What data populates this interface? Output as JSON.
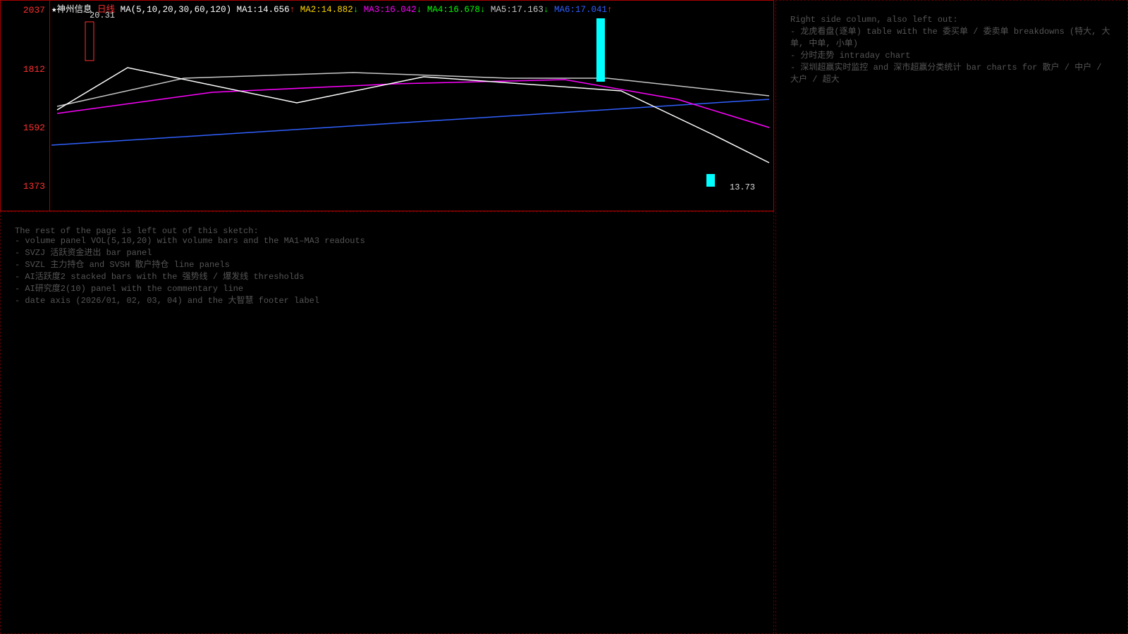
{
  "main": {
    "title": "★神州信息",
    "period": "日线",
    "ticks": [
      "2037",
      "1812",
      "1592",
      "1373"
    ],
    "ma_label": "MA(5,10,20,30,60,120)",
    "ma": [
      {
        "name": "MA1:",
        "value": "14.656",
        "arrow": "↑",
        "color": "#ffffff"
      },
      {
        "name": "MA2:",
        "value": "14.882",
        "arrow": "↓",
        "color": "#ffd700"
      },
      {
        "name": "MA3:",
        "value": "16.042",
        "arrow": "↓",
        "color": "#ff00ff"
      },
      {
        "name": "MA4:",
        "value": "16.678",
        "arrow": "↓",
        "color": "#00ff00"
      },
      {
        "name": "MA5:",
        "value": "17.163",
        "arrow": "↓",
        "color": "#c8c8c8"
      },
      {
        "name": "MA6:",
        "value": "17.041",
        "arrow": "↑",
        "color": "#3060ff"
      }
    ],
    "high_label": "20.31",
    "low_label": "13.73"
  }
}
